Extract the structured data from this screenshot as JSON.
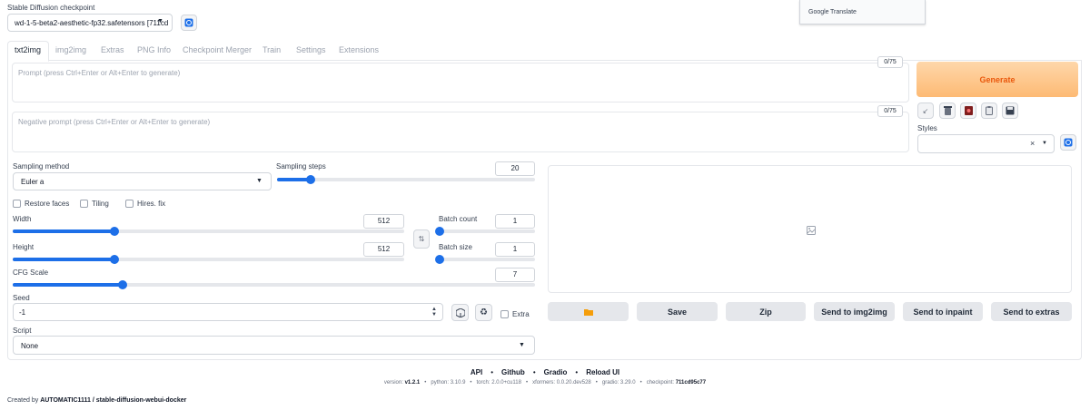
{
  "checkpoint": {
    "label": "Stable Diffusion checkpoint",
    "value": "wd-1-5-beta2-aesthetic-fp32.safetensors [711cd"
  },
  "translate": {
    "brand": "Google",
    "label": "Translate"
  },
  "tabs": [
    {
      "label": "txt2img"
    },
    {
      "label": "img2img"
    },
    {
      "label": "Extras"
    },
    {
      "label": "PNG Info"
    },
    {
      "label": "Checkpoint Merger"
    },
    {
      "label": "Train"
    },
    {
      "label": "Settings"
    },
    {
      "label": "Extensions"
    }
  ],
  "prompt": {
    "placeholder": "Prompt (press Ctrl+Enter or Alt+Enter to generate)",
    "counter": "0/75"
  },
  "negative_prompt": {
    "placeholder": "Negative prompt (press Ctrl+Enter or Alt+Enter to generate)",
    "counter": "0/75"
  },
  "generate": {
    "label": "Generate",
    "color": "#ea580c"
  },
  "styles": {
    "label": "Styles",
    "clear": "×"
  },
  "sampling_method": {
    "label": "Sampling method",
    "value": "Euler a"
  },
  "sampling_steps": {
    "label": "Sampling steps",
    "value": "20",
    "fraction": 0.13
  },
  "checkboxes": {
    "restore_faces": "Restore faces",
    "tiling": "Tiling",
    "hires_fix": "Hires. fix"
  },
  "width": {
    "label": "Width",
    "value": "512",
    "fraction": 0.26
  },
  "height": {
    "label": "Height",
    "value": "512",
    "fraction": 0.26
  },
  "batch_count": {
    "label": "Batch count",
    "value": "1",
    "fraction": 0.0
  },
  "batch_size": {
    "label": "Batch size",
    "value": "1",
    "fraction": 0.0
  },
  "cfg_scale": {
    "label": "CFG Scale",
    "value": "7",
    "fraction": 0.21
  },
  "seed": {
    "label": "Seed",
    "value": "-1",
    "extra": "Extra"
  },
  "script": {
    "label": "Script",
    "value": "None"
  },
  "output_buttons": {
    "save": "Save",
    "zip": "Zip",
    "send_img2img": "Send to img2img",
    "send_inpaint": "Send to inpaint",
    "send_extras": "Send to extras"
  },
  "footer": {
    "links": [
      "API",
      "Github",
      "Gradio",
      "Reload UI"
    ],
    "separator": "•",
    "version_prefix": "version: ",
    "version": "v1.2.1",
    "python": "python: 3.10.9",
    "torch": "torch: 2.0.0+cu118",
    "xformers": "xformers: 0.0.20.dev528",
    "gradio": "gradio: 3.29.0",
    "checkpoint_prefix": "checkpoint: ",
    "checkpoint": "711cd95c77",
    "created_by_prefix": "Created by ",
    "created_by": "AUTOMATIC1111 / stable-diffusion-webui-docker"
  }
}
